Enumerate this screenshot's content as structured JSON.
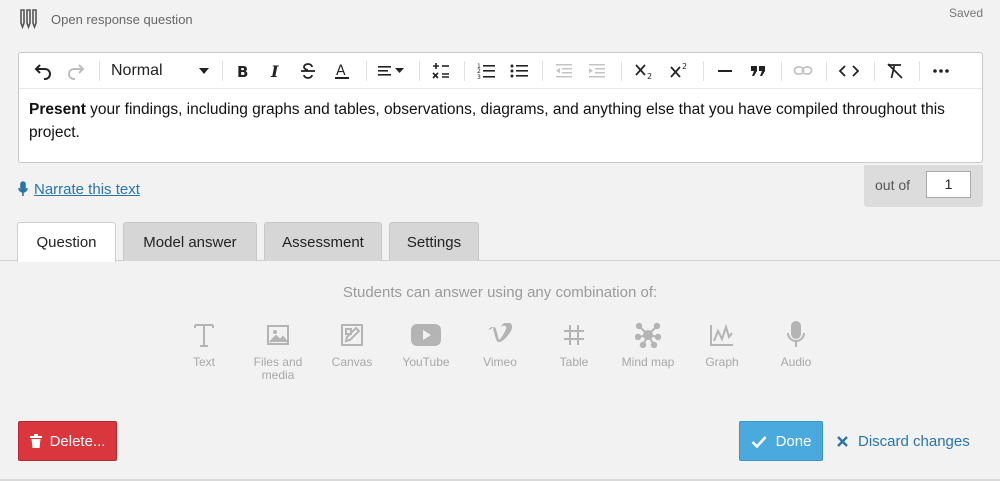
{
  "header": {
    "question_type": "Open response question",
    "save_status": "Saved"
  },
  "toolbar": {
    "style_value": "Normal",
    "items": [
      "undo-icon",
      "redo-icon",
      "bold-icon",
      "italic-icon",
      "strikethrough-icon",
      "text-color-icon",
      "align-icon",
      "math-icon",
      "ordered-list-icon",
      "bullet-list-icon",
      "outdent-icon",
      "indent-icon",
      "subscript-icon",
      "superscript-icon",
      "horizontal-rule-icon",
      "blockquote-icon",
      "link-icon",
      "code-icon",
      "clear-format-icon",
      "more-icon"
    ]
  },
  "editor": {
    "bold_word": "Present",
    "body_text": " your findings, including graphs and tables, observations, diagrams, and anything else that you have compiled throughout this project."
  },
  "narrate": {
    "label": "Narrate this text"
  },
  "points": {
    "label": "out of",
    "value": "1"
  },
  "tabs": [
    {
      "label": "Question",
      "active": true
    },
    {
      "label": "Model answer",
      "active": false
    },
    {
      "label": "Assessment",
      "active": false
    },
    {
      "label": "Settings",
      "active": false
    }
  ],
  "answer_types": {
    "heading": "Students can answer using any combination of:",
    "options": [
      {
        "label": "Text",
        "icon": "text-icon"
      },
      {
        "label": "Files and media",
        "icon": "image-icon"
      },
      {
        "label": "Canvas",
        "icon": "canvas-icon"
      },
      {
        "label": "YouTube",
        "icon": "youtube-icon"
      },
      {
        "label": "Vimeo",
        "icon": "vimeo-icon"
      },
      {
        "label": "Table",
        "icon": "table-icon"
      },
      {
        "label": "Mind map",
        "icon": "mind-map-icon"
      },
      {
        "label": "Graph",
        "icon": "graph-icon"
      },
      {
        "label": "Audio",
        "icon": "microphone-icon"
      }
    ]
  },
  "actions": {
    "delete_label": "Delete...",
    "done_label": "Done",
    "discard_label": "Discard changes"
  },
  "colors": {
    "delete": "#d9363e",
    "done": "#4aaade",
    "link": "#2a74a8"
  }
}
